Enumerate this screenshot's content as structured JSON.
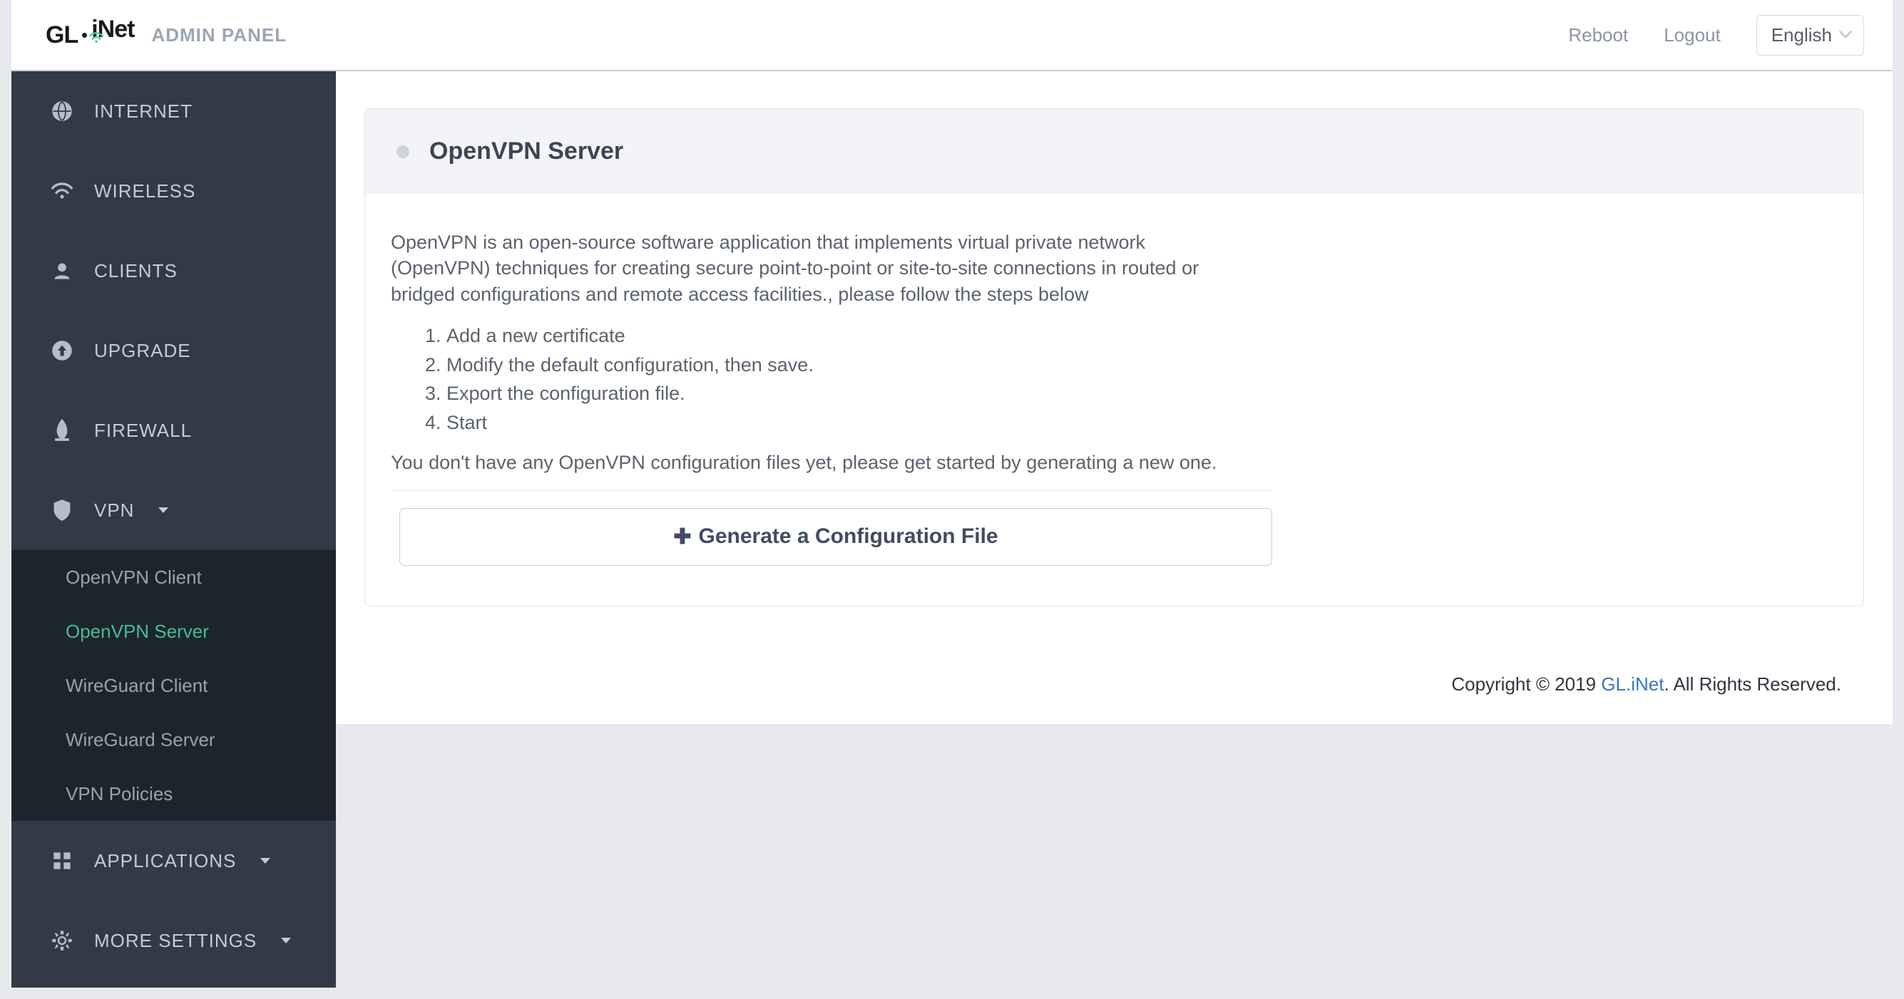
{
  "header": {
    "brand_left": "GL",
    "brand_right": "iNet",
    "admin_label": "ADMIN PANEL",
    "reboot": "Reboot",
    "logout": "Logout",
    "language": "English"
  },
  "sidebar": {
    "items": [
      {
        "label": "INTERNET"
      },
      {
        "label": "WIRELESS"
      },
      {
        "label": "CLIENTS"
      },
      {
        "label": "UPGRADE"
      },
      {
        "label": "FIREWALL"
      },
      {
        "label": "VPN"
      },
      {
        "label": "APPLICATIONS"
      },
      {
        "label": "MORE SETTINGS"
      }
    ],
    "vpn_sub": [
      {
        "label": "OpenVPN Client"
      },
      {
        "label": "OpenVPN Server"
      },
      {
        "label": "WireGuard Client"
      },
      {
        "label": "WireGuard Server"
      },
      {
        "label": "VPN Policies"
      }
    ]
  },
  "main": {
    "title": "OpenVPN Server",
    "description": "OpenVPN is an open-source software application that implements virtual private network (OpenVPN) techniques for creating secure point-to-point or site-to-site connections in routed or bridged configurations and remote access facilities., please follow the steps below",
    "steps": [
      "Add a new certificate",
      "Modify the default configuration, then save.",
      "Export the configuration file.",
      "Start"
    ],
    "no_config": "You don't have any OpenVPN configuration files yet, please get started by generating a new one.",
    "generate_button": "Generate a Configuration File"
  },
  "footer": {
    "copyright_prefix": "Copyright © 2019 ",
    "brand_link": "GL.iNet",
    "copyright_suffix": ". All Rights Reserved."
  }
}
